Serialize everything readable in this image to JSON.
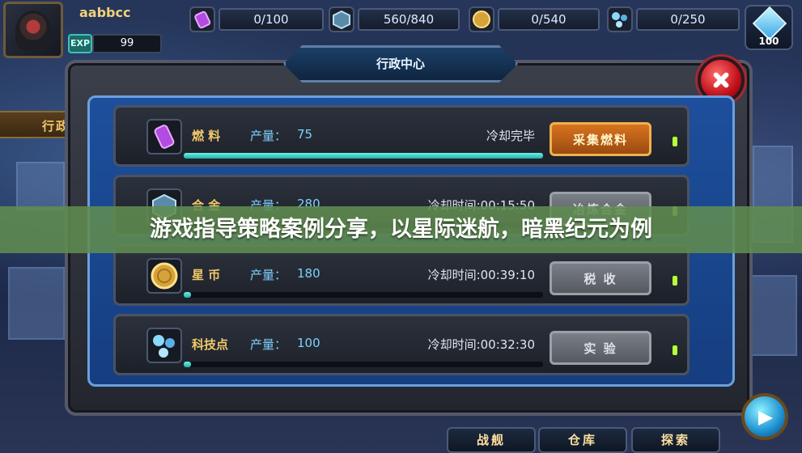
{
  "hud": {
    "player_name": "aabbcc",
    "exp_label": "EXP",
    "exp_value": "99",
    "resources": [
      {
        "icon": "fuel-canister-icon",
        "value": "0/100"
      },
      {
        "icon": "alloy-crate-icon",
        "value": "560/840"
      },
      {
        "icon": "star-coin-icon",
        "value": "0/540"
      },
      {
        "icon": "tech-orb-icon",
        "value": "0/250"
      }
    ],
    "crystal": {
      "icon": "crystal-gem-icon",
      "value": "100"
    }
  },
  "side_tab": {
    "label": "行政"
  },
  "panel": {
    "title": "行政中心",
    "rows": [
      {
        "name": "燃 料",
        "prod_label": "产量：",
        "prod_value": "75",
        "status": "冷却完毕",
        "button": "采集燃料",
        "progress": 1.0,
        "icon": "fuel-canister-icon"
      },
      {
        "name": "合 金",
        "prod_label": "产量：",
        "prod_value": "280",
        "status": "冷却时间:00:15:50",
        "button": "冶炼合金",
        "progress": 0.02,
        "icon": "alloy-crate-icon"
      },
      {
        "name": "星 币",
        "prod_label": "产量：",
        "prod_value": "180",
        "status": "冷却时间:00:39:10",
        "button": "税    收",
        "progress": 0.02,
        "icon": "star-coin-icon"
      },
      {
        "name": "科技点",
        "prod_label": "产量：",
        "prod_value": "100",
        "status": "冷却时间:00:32:30",
        "button": "实    验",
        "progress": 0.02,
        "icon": "tech-orb-icon"
      }
    ]
  },
  "bottom_nav": [
    {
      "label": "战舰"
    },
    {
      "label": "仓库"
    },
    {
      "label": "探索"
    }
  ],
  "banner": {
    "text": "游戏指导策略案例分享，以星际迷航，暗黑纪元为例"
  }
}
